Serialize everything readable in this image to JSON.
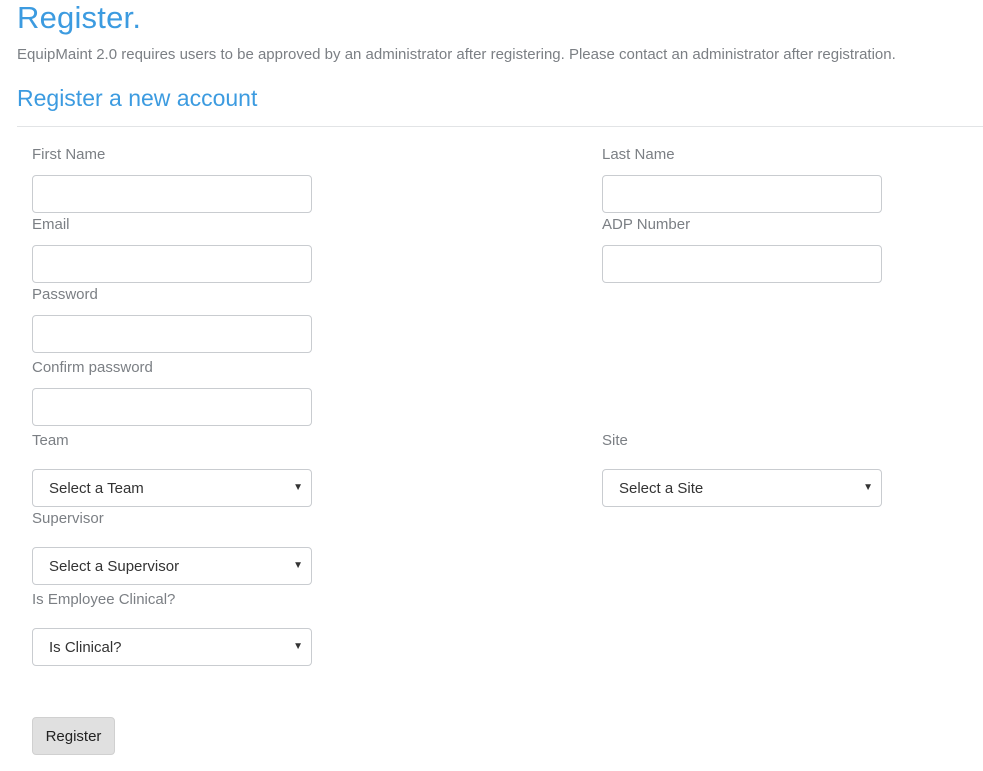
{
  "header": {
    "title": "Register.",
    "notice": "EquipMaint 2.0 requires users to be approved by an administrator after registering. Please contact an administrator after registration.",
    "section_title": "Register a new account"
  },
  "form": {
    "first_name": {
      "label": "First Name",
      "value": ""
    },
    "last_name": {
      "label": "Last Name",
      "value": ""
    },
    "email": {
      "label": "Email",
      "value": ""
    },
    "adp_number": {
      "label": "ADP Number",
      "value": ""
    },
    "password": {
      "label": "Password",
      "value": ""
    },
    "confirm_password": {
      "label": "Confirm password",
      "value": ""
    },
    "team": {
      "label": "Team",
      "selected": "Select a Team"
    },
    "site": {
      "label": "Site",
      "selected": "Select a Site"
    },
    "supervisor": {
      "label": "Supervisor",
      "selected": "Select a Supervisor"
    },
    "clinical": {
      "label": "Is Employee Clinical?",
      "selected": "Is Clinical?"
    },
    "dropdown_icon": "triangle-down",
    "submit_label": "Register"
  },
  "colors": {
    "accent": "#3c9be0",
    "label": "#7b7f84",
    "button_bg": "#e0e0e0"
  }
}
